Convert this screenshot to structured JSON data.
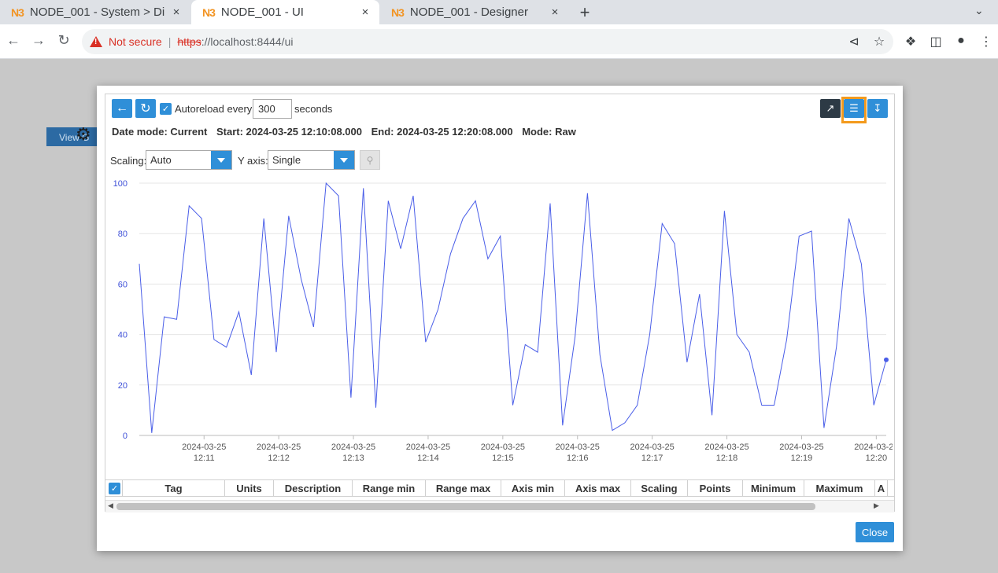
{
  "browser": {
    "tabs": [
      {
        "logo": "N3",
        "title": "NODE_001 - System > Di",
        "close": "×"
      },
      {
        "logo": "N3",
        "title": "NODE_001 - UI",
        "close": "×"
      },
      {
        "logo": "N3",
        "title": "NODE_001 - Designer",
        "close": "×"
      }
    ],
    "new_tab": "+",
    "address": {
      "warning": "Not secure",
      "separator": "|",
      "scheme": "https",
      "host": "://localhost",
      "path": ":8444/ui"
    }
  },
  "page": {
    "background_button": "View G"
  },
  "dialog": {
    "autoreload_label": "Autoreload every",
    "autoreload_value": "300",
    "autoreload_unit": "seconds",
    "info": {
      "date_mode": "Date mode: Current",
      "start": "Start: 2024-03-25 12:10:08.000",
      "end": "End: 2024-03-25 12:20:08.000",
      "mode": "Mode: Raw"
    },
    "scaling_label": "Scaling:",
    "scaling_value": "Auto",
    "yaxis_label": "Y axis:",
    "yaxis_value": "Single",
    "close_label": "Close",
    "table_columns": [
      "Tag",
      "Units",
      "Description",
      "Range min",
      "Range max",
      "Axis min",
      "Axis max",
      "Scaling",
      "Points",
      "Minimum",
      "Maximum",
      "A"
    ]
  },
  "chart_data": {
    "type": "line",
    "title": "",
    "xlabel": "",
    "ylabel": "",
    "ylim": [
      0,
      100
    ],
    "yticks": [
      0,
      20,
      40,
      60,
      80,
      100
    ],
    "xticks": [
      {
        "date": "2024-03-25",
        "time": "12:11"
      },
      {
        "date": "2024-03-25",
        "time": "12:12"
      },
      {
        "date": "2024-03-25",
        "time": "12:13"
      },
      {
        "date": "2024-03-25",
        "time": "12:14"
      },
      {
        "date": "2024-03-25",
        "time": "12:15"
      },
      {
        "date": "2024-03-25",
        "time": "12:16"
      },
      {
        "date": "2024-03-25",
        "time": "12:17"
      },
      {
        "date": "2024-03-25",
        "time": "12:18"
      },
      {
        "date": "2024-03-25",
        "time": "12:19"
      },
      {
        "date": "2024-03-25",
        "time": "12:20"
      }
    ],
    "x_start": "12:10:08",
    "x_end": "12:20:08",
    "color": "#4a5ee8",
    "series": [
      {
        "values": [
          68,
          1,
          47,
          46,
          91,
          86,
          38,
          35,
          49,
          24,
          86,
          33,
          87,
          62,
          43,
          100,
          95,
          15,
          98,
          11,
          93,
          74,
          95,
          37,
          50,
          72,
          86,
          93,
          70,
          79,
          12,
          36,
          33,
          92,
          4,
          39,
          96,
          32,
          2,
          5,
          12,
          40,
          84,
          76,
          29,
          56,
          8,
          89,
          40,
          33,
          12,
          12,
          38,
          79,
          81,
          3,
          35,
          86,
          68,
          12,
          30
        ]
      }
    ]
  }
}
